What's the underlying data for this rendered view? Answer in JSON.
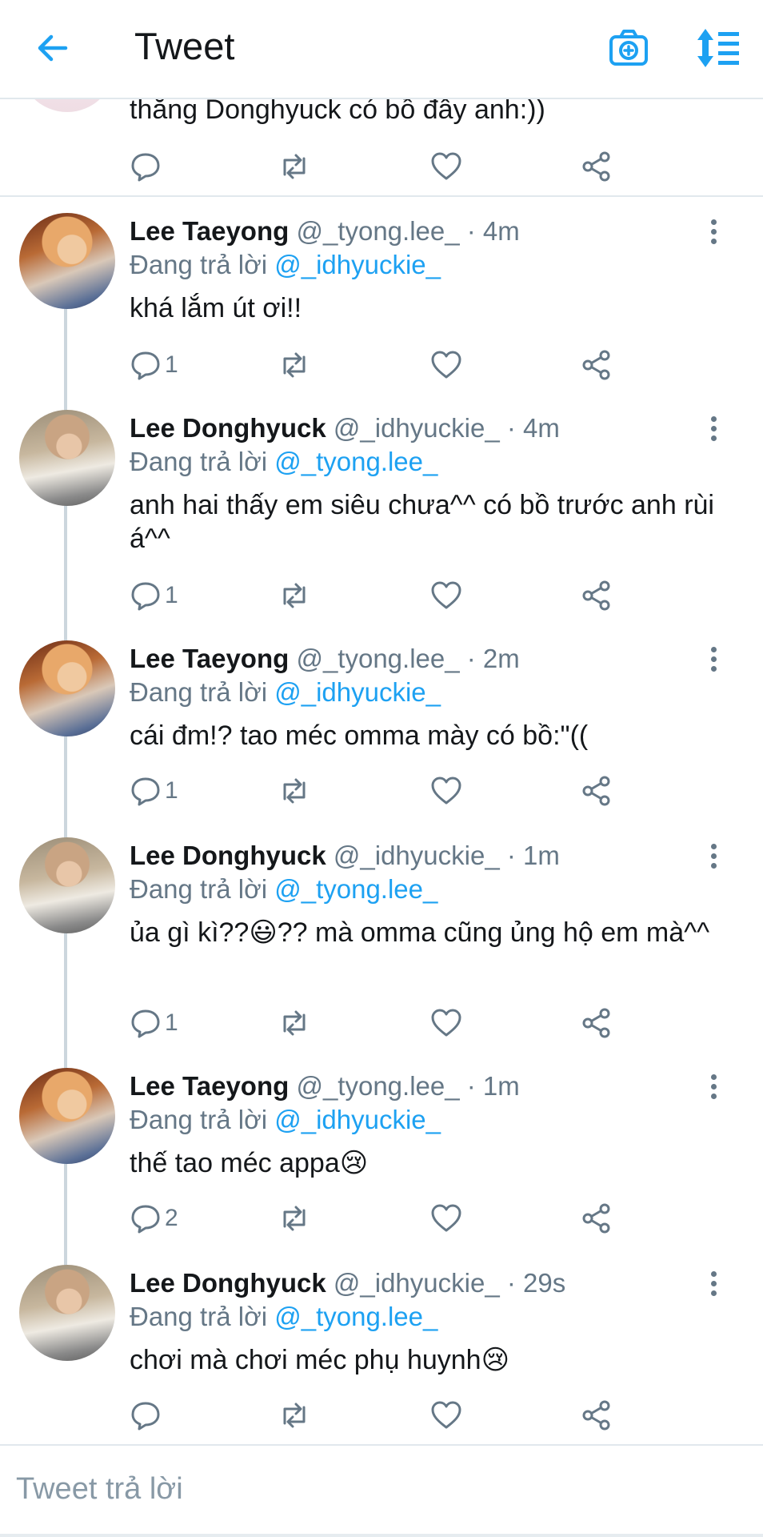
{
  "header": {
    "title": "Tweet",
    "back_icon": "arrow-left-icon",
    "camera_icon": "camera-plus-icon",
    "sort_icon": "sort-thread-icon",
    "accent": "#1da1f2"
  },
  "partial_tweet": {
    "text": "thằng Donghyuck có bồ đây anh:))"
  },
  "labels": {
    "replying_to": "Đang trả lời"
  },
  "tweets": [
    {
      "name": "Lee Taeyong",
      "handle": "@_tyong.lee_ · 4m",
      "reply_to": "@_idhyuckie_",
      "text": "khá lắm út ơi!!",
      "reply_count": "1"
    },
    {
      "name": "Lee Donghyuck",
      "handle": "@_idhyuckie_ · 4m",
      "reply_to": "@_tyong.lee_",
      "text": "anh hai thấy em siêu chưa^^ có bồ trước anh rùi á^^",
      "reply_count": "1"
    },
    {
      "name": "Lee Taeyong",
      "handle": "@_tyong.lee_ · 2m",
      "reply_to": "@_idhyuckie_",
      "text": "cái đm!? tao méc omma mày có bồ:\"((",
      "reply_count": "1"
    },
    {
      "name": "Lee Donghyuck",
      "handle": "@_idhyuckie_ · 1m",
      "reply_to": "@_tyong.lee_",
      "text": "ủa gì kì??😃?? mà omma cũng ủng hộ em mà^^",
      "reply_count": "1"
    },
    {
      "name": "Lee Taeyong",
      "handle": "@_tyong.lee_ · 1m",
      "reply_to": "@_idhyuckie_",
      "text": "thế tao méc appa😢",
      "reply_count": "2"
    },
    {
      "name": "Lee Donghyuck",
      "handle": "@_idhyuckie_ · 29s",
      "reply_to": "@_tyong.lee_",
      "text": "chơi mà chơi méc phụ huynh😢",
      "reply_count": ""
    }
  ],
  "reply_bar": {
    "placeholder": "Tweet trả lời"
  }
}
